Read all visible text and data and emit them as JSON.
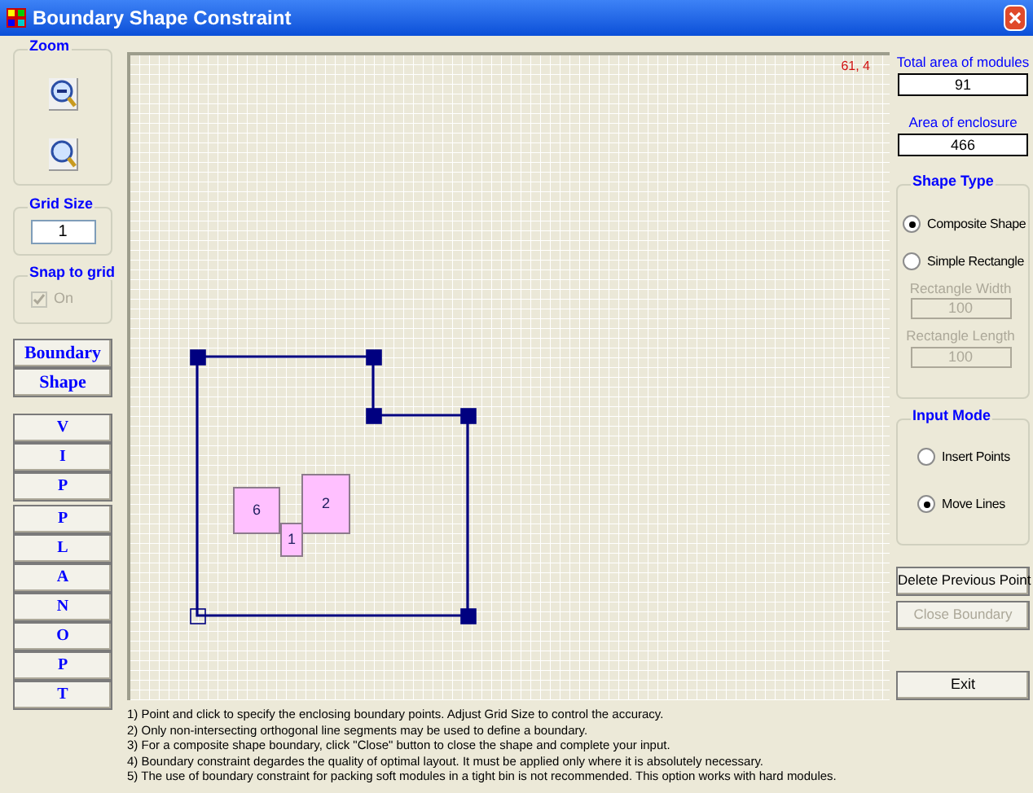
{
  "window": {
    "title": "Boundary Shape Constraint"
  },
  "zoom": {
    "label": "Zoom"
  },
  "grid_size": {
    "label": "Grid Size",
    "value": "1"
  },
  "snap": {
    "label": "Snap to grid",
    "option": "On",
    "checked": true,
    "disabled": true
  },
  "mode_buttons": [
    "Boundary",
    "Shape"
  ],
  "letter_groups": [
    [
      "V",
      "I",
      "P"
    ],
    [
      "P",
      "L",
      "A",
      "N",
      "O",
      "P",
      "T"
    ]
  ],
  "canvas": {
    "cursor": "61, 4",
    "modules": [
      "6",
      "2",
      "1"
    ],
    "points": [
      {
        "filled": true
      },
      {
        "filled": true
      },
      {
        "filled": true
      },
      {
        "filled": true
      },
      {
        "filled": true
      },
      {
        "filled": false
      }
    ]
  },
  "total_area": {
    "label": "Total area of modules",
    "value": "91"
  },
  "enclosure_area": {
    "label": "Area of enclosure",
    "value": "466"
  },
  "shape_type": {
    "label": "Shape Type",
    "options": [
      {
        "label": "Composite Shape",
        "selected": true
      },
      {
        "label": "Simple Rectangle",
        "selected": false
      }
    ],
    "fields": [
      {
        "label": "Rectangle Width",
        "value": "100",
        "disabled": true
      },
      {
        "label": "Rectangle Length",
        "value": "100",
        "disabled": true
      }
    ]
  },
  "input_mode": {
    "label": "Input Mode",
    "options": [
      {
        "label": "Insert Points",
        "selected": false
      },
      {
        "label": "Move Lines",
        "selected": true
      }
    ]
  },
  "buttons": [
    {
      "label": "Delete Previous Point",
      "disabled": false
    },
    {
      "label": "Close Boundary",
      "disabled": true
    }
  ],
  "exit": {
    "label": "Exit"
  },
  "instructions": [
    "1) Point and click to specify the enclosing boundary points. Adjust Grid Size to control the accuracy.",
    "2) Only non-intersecting orthogonal line segments may be used to define a boundary.",
    "3) For a composite shape boundary, click \"Close\" button to close the shape and complete your input.",
    "4) Boundary constraint degardes the quality of optimal layout. It must be applied only where it is absolutely necessary.",
    "5) The use of boundary constraint for packing soft modules in a tight bin is not recommended. This option works with hard modules."
  ]
}
